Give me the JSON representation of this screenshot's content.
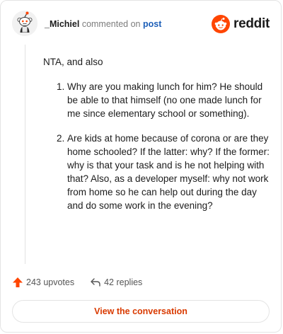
{
  "header": {
    "username": "_Michiel",
    "action": "commented on",
    "post_link": "post",
    "brand": "reddit"
  },
  "comment": {
    "intro": "NTA, and also",
    "items": [
      "Why are you making lunch for him? He should be able to that himself (no one made lunch for me since elementary school or something).",
      "Are kids at home because of corona or are they home schooled? If the latter: why? If the former: why is that your task and is he not helping with that? Also, as a developer myself: why not work from home so he can help out during the day and do some work in the evening?"
    ]
  },
  "footer": {
    "upvotes": "243 upvotes",
    "replies": "42 replies",
    "cta": "View the conversation"
  },
  "colors": {
    "accent": "#d93a00",
    "reddit_orange": "#ff4500",
    "link": "#1d5fb8"
  },
  "icons": {
    "avatar": "snoo-avatar-icon",
    "logo": "reddit-logo-icon",
    "upvote": "upvote-arrow-icon",
    "reply": "reply-arrow-icon"
  }
}
